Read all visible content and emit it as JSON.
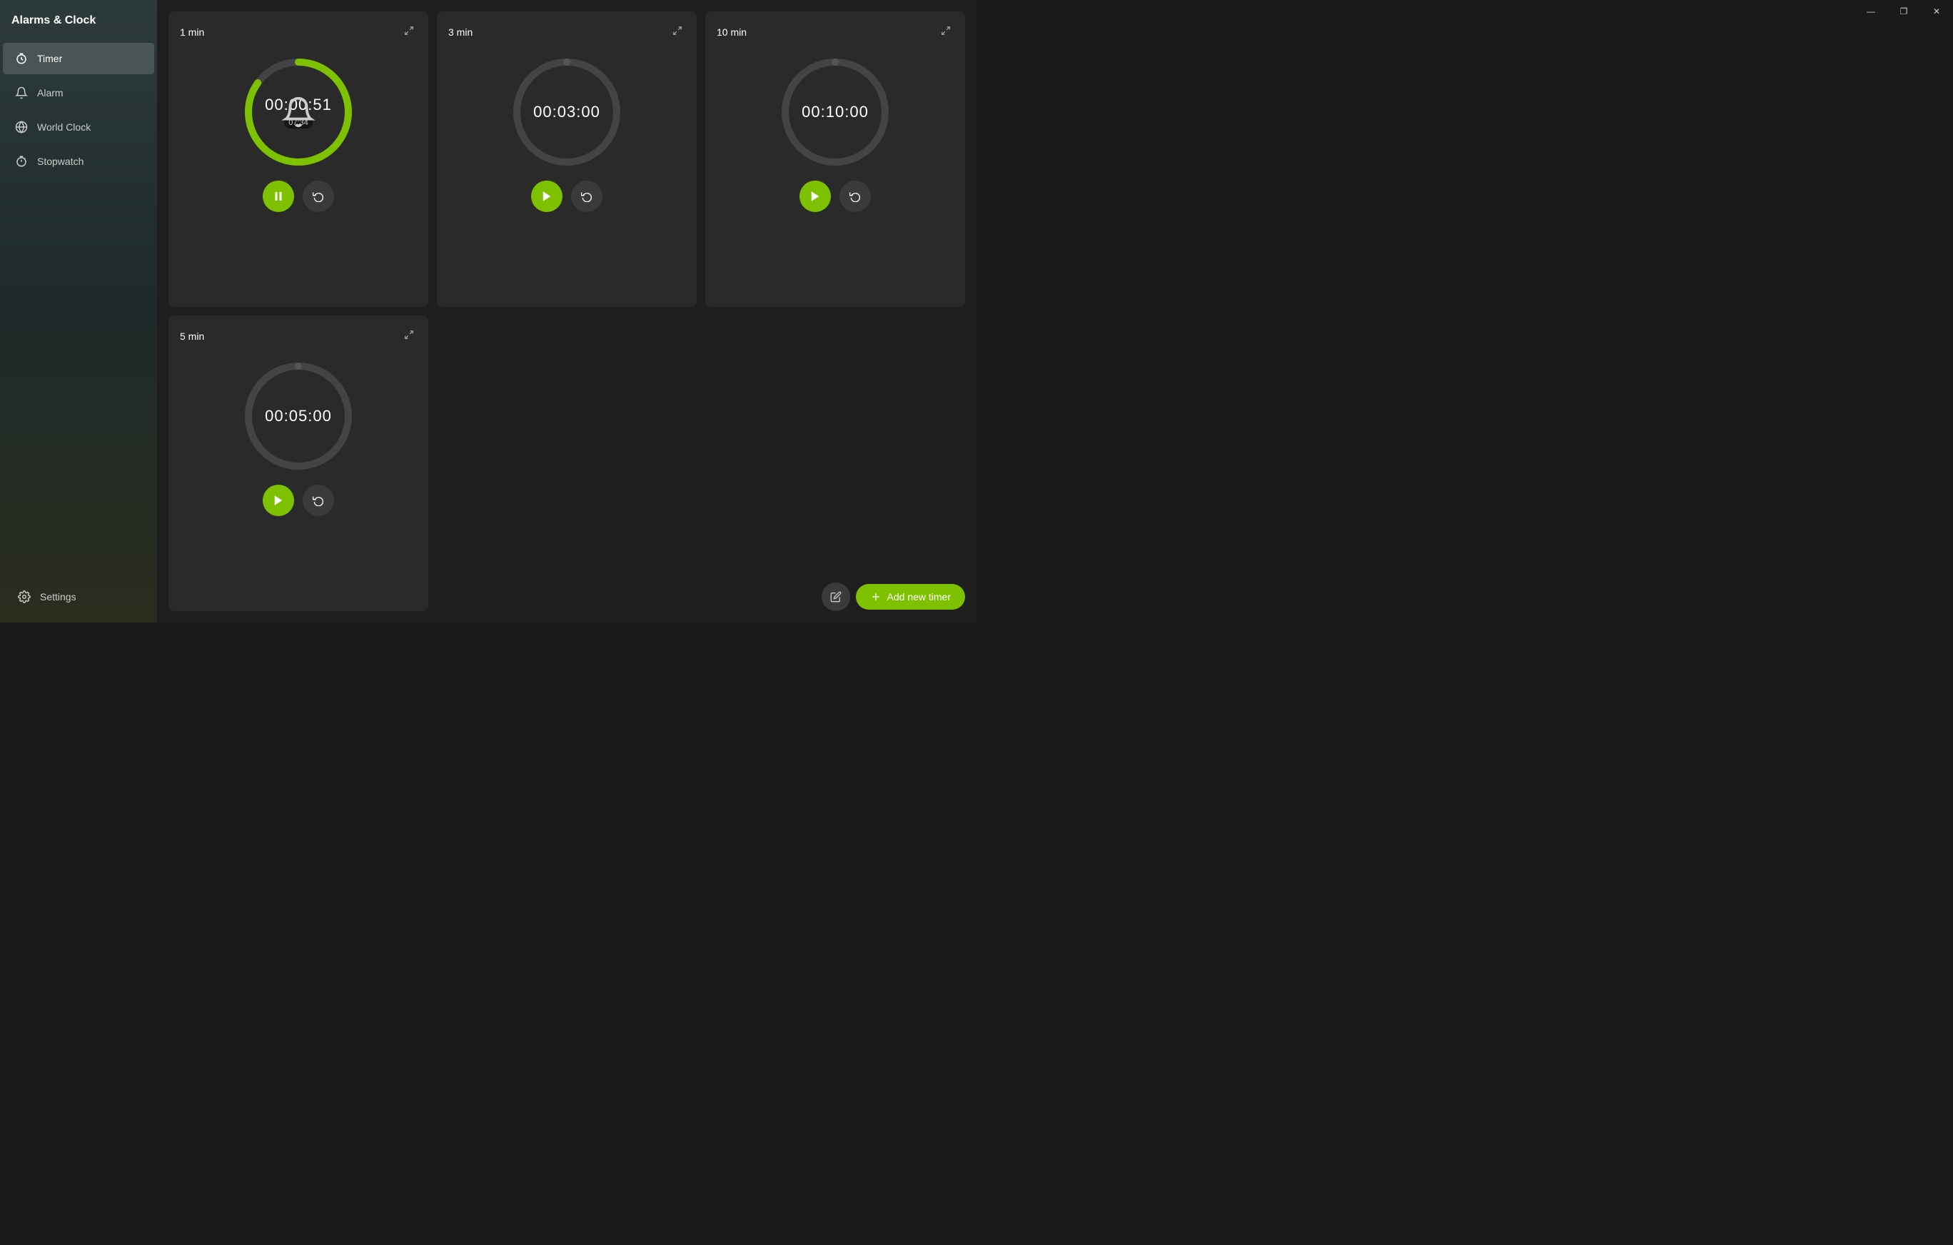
{
  "app": {
    "title": "Alarms & Clock"
  },
  "titlebar": {
    "minimize": "—",
    "maximize": "❐",
    "close": "✕"
  },
  "sidebar": {
    "items": [
      {
        "id": "timer",
        "label": "Timer",
        "icon": "⏱",
        "active": true
      },
      {
        "id": "alarm",
        "label": "Alarm",
        "icon": "🔔",
        "active": false
      },
      {
        "id": "world-clock",
        "label": "World Clock",
        "icon": "🌐",
        "active": false
      },
      {
        "id": "stopwatch",
        "label": "Stopwatch",
        "icon": "⏲",
        "active": false
      }
    ],
    "settings_label": "Settings"
  },
  "timers": [
    {
      "id": "timer-1",
      "label": "1 min",
      "time": "00:00:51",
      "alarm": "07:34",
      "state": "running",
      "progress": 0.85,
      "ring": "green"
    },
    {
      "id": "timer-2",
      "label": "3 min",
      "time": "00:03:00",
      "alarm": null,
      "state": "stopped",
      "progress": 0,
      "ring": "gray"
    },
    {
      "id": "timer-3",
      "label": "10 min",
      "time": "00:10:00",
      "alarm": null,
      "state": "stopped",
      "progress": 0,
      "ring": "gray"
    },
    {
      "id": "timer-4",
      "label": "5 min",
      "time": "00:05:00",
      "alarm": null,
      "state": "stopped",
      "progress": 0,
      "ring": "gray"
    }
  ],
  "bottom_bar": {
    "edit_icon": "✏",
    "add_label": "+ Add new timer"
  }
}
